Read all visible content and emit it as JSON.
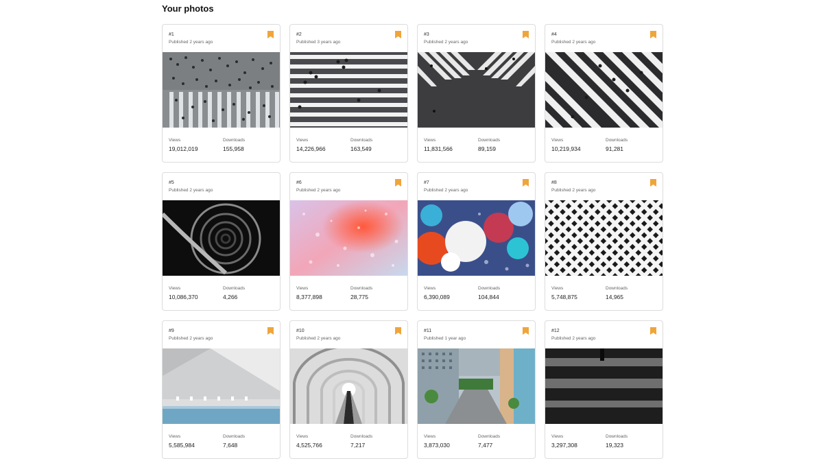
{
  "page": {
    "title": "Your photos"
  },
  "labels": {
    "views": "Views",
    "downloads": "Downloads"
  },
  "colors": {
    "bookmark": "#f0a53a",
    "border": "#dcdcdc"
  },
  "photos": [
    {
      "rank": "#1",
      "published": "Published 2 years ago",
      "views": "19,012,019",
      "downloads": "155,958",
      "bookmarked": true,
      "subject": "crowd-crosswalk-aerial"
    },
    {
      "rank": "#2",
      "published": "Published 3 years ago",
      "views": "14,226,966",
      "downloads": "163,549",
      "bookmarked": true,
      "subject": "crosswalk-stripes-pedestrians"
    },
    {
      "rank": "#3",
      "published": "Published 2 years ago",
      "views": "11,831,566",
      "downloads": "89,159",
      "bookmarked": true,
      "subject": "diagonal-crosswalk"
    },
    {
      "rank": "#4",
      "published": "Published 2 years ago",
      "views": "10,219,934",
      "downloads": "91,281",
      "bookmarked": true,
      "subject": "diagonal-crosswalk-walkers"
    },
    {
      "rank": "#5",
      "published": "Published 2 years ago",
      "views": "10,086,370",
      "downloads": "4,266",
      "bookmarked": false,
      "subject": "spiral-staircase"
    },
    {
      "rank": "#6",
      "published": "Published 2 years ago",
      "views": "8,377,898",
      "downloads": "28,775",
      "bookmarked": true,
      "subject": "water-drops-pink"
    },
    {
      "rank": "#7",
      "published": "Published 2 years ago",
      "views": "6,390,089",
      "downloads": "104,844",
      "bookmarked": true,
      "subject": "water-drops-bokeh"
    },
    {
      "rank": "#8",
      "published": "Published 2 years ago",
      "views": "5,748,875",
      "downloads": "14,965",
      "bookmarked": true,
      "subject": "building-facade-pattern"
    },
    {
      "rank": "#9",
      "published": "Published 2 years ago",
      "views": "5,585,984",
      "downloads": "7,648",
      "bookmarked": true,
      "subject": "minimal-pool-building"
    },
    {
      "rank": "#10",
      "published": "Published 2 years ago",
      "views": "4,525,766",
      "downloads": "7,217",
      "bookmarked": true,
      "subject": "escalator-tunnel"
    },
    {
      "rank": "#11",
      "published": "Published 1 year ago",
      "views": "3,873,030",
      "downloads": "7,477",
      "bookmarked": true,
      "subject": "apartment-buildings-road"
    },
    {
      "rank": "#12",
      "published": "Published 2 years ago",
      "views": "3,297,308",
      "downloads": "19,323",
      "bookmarked": true,
      "subject": "shadows-pedestrian"
    }
  ]
}
